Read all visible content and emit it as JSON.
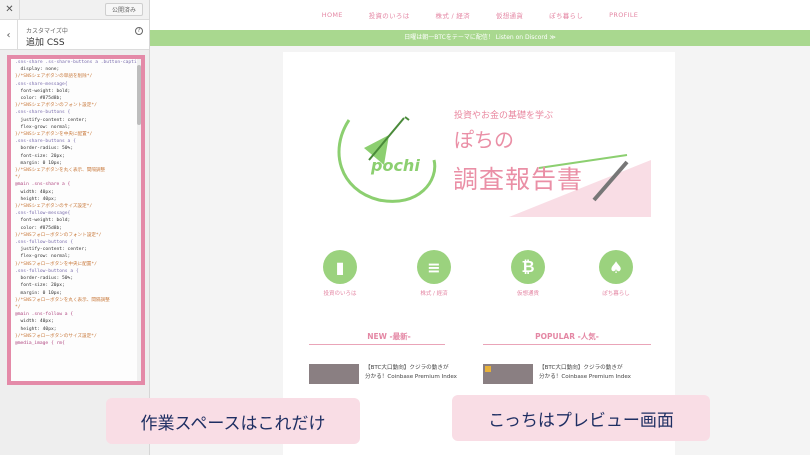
{
  "sidebar": {
    "close_glyph": "✕",
    "publish_label": "公開済み",
    "back_glyph": "‹",
    "subtitle": "カスタマイズ中",
    "title": "追加 CSS",
    "help_glyph": "?",
    "code_lines": [
      {
        "t": ".sns-share .ss-share-buttons a .button-caption{",
        "c": "sel"
      },
      {
        "t": "  display: none;",
        "c": ""
      },
      {
        "t": "}/*SNSシェアボタンの単語を削除*/",
        "c": "cm"
      },
      {
        "t": ".sns-share-message{",
        "c": "sel"
      },
      {
        "t": "  font-weight: bold;",
        "c": ""
      },
      {
        "t": "  color: #875d8b;",
        "c": ""
      },
      {
        "t": "}/*SNSシェアボタンのフォント設定*/",
        "c": "cm"
      },
      {
        "t": ".sns-share-buttons {",
        "c": "sel"
      },
      {
        "t": "  justify-content: center;",
        "c": ""
      },
      {
        "t": "  flex-grow: normal;",
        "c": ""
      },
      {
        "t": "}/*SNSシェアボタンを中央に配置*/",
        "c": "cm"
      },
      {
        "t": ".sns-share-buttons a {",
        "c": "sel"
      },
      {
        "t": "  border-radius: 50%;",
        "c": ""
      },
      {
        "t": "  font-size: 20px;",
        "c": ""
      },
      {
        "t": "  margin: 0 10px;",
        "c": ""
      },
      {
        "t": "}/*SNSシェアボタンを丸く表示、間隔調整",
        "c": "cm"
      },
      {
        "t": "*/",
        "c": "cm"
      },
      {
        "t": "@main .sns-share a {",
        "c": "kw"
      },
      {
        "t": "  width: 40px;",
        "c": ""
      },
      {
        "t": "  height: 40px;",
        "c": ""
      },
      {
        "t": "}/*SNSシェアボタンのサイズ設定*/",
        "c": "cm"
      },
      {
        "t": ".sns-follow-message{",
        "c": "sel"
      },
      {
        "t": "  font-weight: bold;",
        "c": ""
      },
      {
        "t": "  color: #875d8b;",
        "c": ""
      },
      {
        "t": "}/*SNSフォローボタンのフォント設定*/",
        "c": "cm"
      },
      {
        "t": ".sns-follow-buttons {",
        "c": "sel"
      },
      {
        "t": "  justify-content: center;",
        "c": ""
      },
      {
        "t": "  flex-grow: normal;",
        "c": ""
      },
      {
        "t": "}/*SNSフォローボタンを中央に配置*/",
        "c": "cm"
      },
      {
        "t": ".sns-follow-buttons a {",
        "c": "sel"
      },
      {
        "t": "  border-radius: 50%;",
        "c": ""
      },
      {
        "t": "  font-size: 20px;",
        "c": ""
      },
      {
        "t": "  margin: 0 10px;",
        "c": ""
      },
      {
        "t": "}/*SNSフォローボタンを丸く表示、間隔調整",
        "c": "cm"
      },
      {
        "t": "*/",
        "c": "cm"
      },
      {
        "t": "@main .sns-follow a {",
        "c": "kw"
      },
      {
        "t": "  width: 40px;",
        "c": ""
      },
      {
        "t": "  height: 40px;",
        "c": ""
      },
      {
        "t": "}/*SNSフォローボタンのサイズ設定*/",
        "c": "cm"
      },
      {
        "t": "@media_image { rm{",
        "c": "kw"
      }
    ]
  },
  "preview": {
    "nav": [
      "HOME",
      "投資のいろは",
      "株式 / 経済",
      "仮想通貨",
      "ぽち暮らし",
      "PROFILE"
    ],
    "banner": "日曜は朝一BTCをテーマに配信！ Listen on Discord ≫",
    "hero": {
      "tagline": "投資やお金の基礎を学ぶ",
      "title1": "ぽちの",
      "title2": "調査報告書",
      "logo": "pochi"
    },
    "categories": [
      {
        "icon": "▮",
        "label": "投資のいろは"
      },
      {
        "icon": "≡",
        "label": "株式 / 経済"
      },
      {
        "icon": "₿",
        "label": "仮想通貨"
      },
      {
        "icon": "♠",
        "label": "ぽち暮らし"
      }
    ],
    "new_title": "NEW -最新-",
    "popular_title": "POPULAR -人気-",
    "new_card": {
      "line1": "【BTC大口動向】クジラの動きが",
      "line2": "分かる！Coinbase Premium Index"
    },
    "popular_card": {
      "line1": "【BTC大口動向】クジラの動きが",
      "line2": "分かる！Coinbase Premium Index"
    }
  },
  "callouts": {
    "left": "作業スペースはこれだけ",
    "right": "こっちはプレビュー画面"
  },
  "colors": {
    "pink": "#e487a4",
    "green": "#9bd27e",
    "callout_bg": "#f9dde5"
  }
}
